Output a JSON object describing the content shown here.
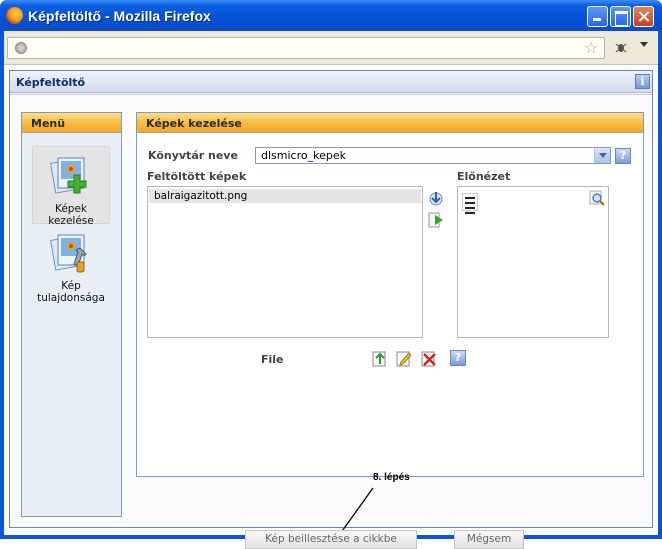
{
  "window": {
    "title": "Képfeltöltő - Mozilla Firefox"
  },
  "app": {
    "title": "Képfeltöltő",
    "menu": {
      "title": "Menü",
      "items": [
        {
          "label_line1": "Képek",
          "label_line2": "kezelése",
          "icon": "image-add-icon",
          "active": true
        },
        {
          "label_line1": "Kép",
          "label_line2": "tulajdonsága",
          "icon": "image-properties-icon",
          "active": false
        }
      ]
    },
    "main": {
      "title": "Képek kezelése",
      "library_label": "Könyvtár neve",
      "library_value": "dlsmicro_kepek",
      "uploaded_label": "Feltöltött képek",
      "uploaded_files": [
        "balraigazitott.png"
      ],
      "preview_label": "Előnézet",
      "file_label": "File"
    },
    "buttons": {
      "insert": "Kép beillesztése a cikkbe",
      "cancel": "Mégsem"
    },
    "annotation": "8. lépés"
  },
  "colors": {
    "accent": "#f6b93c",
    "titlebar": "#0552d6",
    "border": "#7f9db9"
  }
}
